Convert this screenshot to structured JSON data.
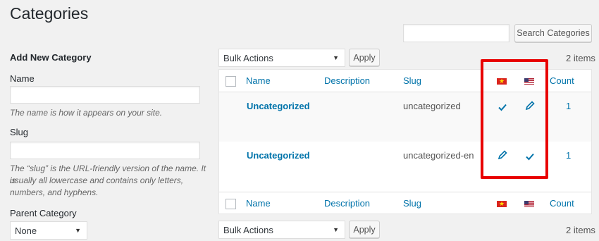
{
  "page": {
    "title": "Categories"
  },
  "search": {
    "button_label": "Search Categories",
    "value": ""
  },
  "add_form": {
    "title": "Add New Category",
    "name_label": "Name",
    "name_hint": "The name is how it appears on your site.",
    "slug_label": "Slug",
    "slug_hint_1": "The “slug” is the URL-friendly version of the name. It is",
    "slug_hint_2": "usually all lowercase and contains only letters,",
    "slug_hint_3": "numbers, and hyphens.",
    "parent_label": "Parent Category",
    "parent_value": "None"
  },
  "bulk": {
    "label": "Bulk Actions",
    "apply": "Apply",
    "items": "2 items"
  },
  "table": {
    "columns": {
      "name": "Name",
      "description": "Description",
      "slug": "Slug",
      "count": "Count"
    },
    "languages": [
      "vi",
      "en"
    ],
    "rows": [
      {
        "name": "Uncategorized",
        "slug": "uncategorized",
        "count": "1",
        "vi": "check",
        "en": "edit"
      },
      {
        "name": "Uncategorized",
        "slug": "uncategorized-en",
        "count": "1",
        "vi": "edit",
        "en": "check"
      }
    ]
  },
  "colors": {
    "link": "#0073aa",
    "highlight": "#e80000"
  }
}
